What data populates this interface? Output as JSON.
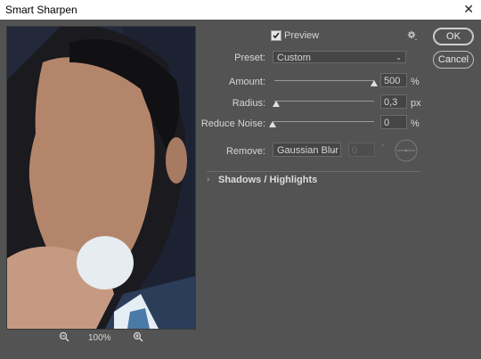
{
  "window": {
    "title": "Smart Sharpen",
    "close_glyph": "✕"
  },
  "preview": {
    "label": "Preview",
    "checked": true
  },
  "preset": {
    "label": "Preset:",
    "value": "Custom"
  },
  "amount": {
    "label": "Amount:",
    "value": "500",
    "unit": "%",
    "level": 1.0
  },
  "radius": {
    "label": "Radius:",
    "value": "0,3",
    "unit": "px",
    "level": 0.02
  },
  "reduce_noise": {
    "label": "Reduce Noise:",
    "value": "0",
    "unit": "%",
    "level": 0.0
  },
  "remove": {
    "label": "Remove:",
    "value": "Gaussian Blur",
    "angle_value": "0",
    "angle_unit": "°"
  },
  "section": {
    "label": "Shadows / Highlights"
  },
  "buttons": {
    "ok": "OK",
    "cancel": "Cancel"
  },
  "zoom": {
    "value": "100%"
  },
  "icons": {
    "gear": "gear-icon",
    "zoom_out": "zoom-out-icon",
    "zoom_in": "zoom-in-icon"
  },
  "colors": {
    "dialog_bg": "#535353",
    "field_bg": "#454545"
  }
}
